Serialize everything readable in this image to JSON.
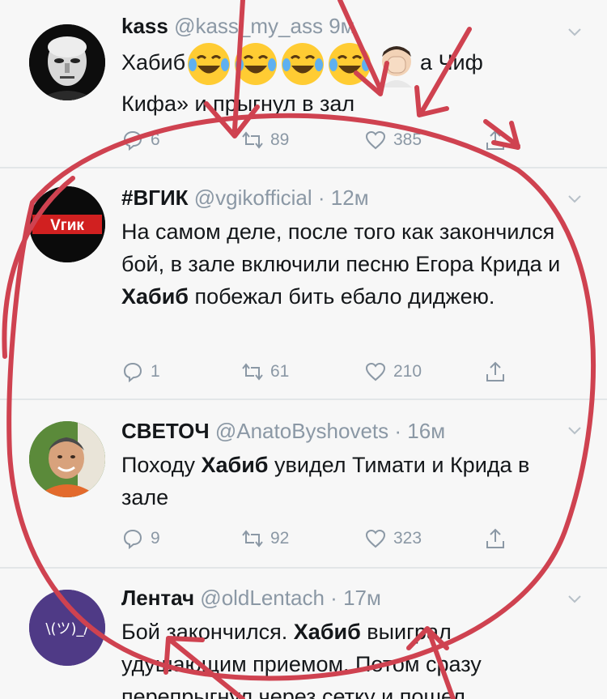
{
  "tweets": [
    {
      "name": "kass",
      "handle": "@kass_my_ass",
      "time": "9м",
      "text_pre": "Хабиб",
      "text_after_emoji": "а Чиф",
      "text_line2": "Кифа» и прыгнул в зал",
      "replies": "6",
      "retweets": "89",
      "likes": "385"
    },
    {
      "name": "#ВГИК",
      "handle": "@vgikofficial",
      "dot": "·",
      "time": "12м",
      "avatar_text": "Vгик",
      "text_pre": "На самом деле, после того как закончился бой, в зале включили песню Егора Крида и ",
      "text_bold": "Хабиб",
      "text_post": " побежал бить ебало диджею.",
      "replies": "1",
      "retweets": "61",
      "likes": "210"
    },
    {
      "name": "СВЕТОЧ",
      "handle": "@AnatoByshovets",
      "dot": "·",
      "time": "16м",
      "text_pre": "Походу ",
      "text_bold": "Хабиб",
      "text_post": " увидел Тимати и Крида в зале",
      "replies": "9",
      "retweets": "92",
      "likes": "323"
    },
    {
      "name": "Лентач",
      "handle": "@oldLentach",
      "dot": "·",
      "time": "17м",
      "avatar_text": "\\(ツ)_/",
      "text_pre": "Бой закончился. ",
      "text_bold": "Хабиб",
      "text_post": " выиграл удушающим приемом. Потом сразу перепрыгнул через сетку и пошел"
    }
  ],
  "colors": {
    "background": "#f7f7f7",
    "text": "#14171a",
    "muted": "#8b98a5",
    "annotation": "#cf4250",
    "vgik_red": "#d12020",
    "lentach_purple": "#4f3a86"
  },
  "icons": [
    "reply-icon",
    "retweet-icon",
    "like-icon",
    "share-icon",
    "chevron-down-icon",
    "laughing-emoji",
    "facepalm-emoji"
  ]
}
